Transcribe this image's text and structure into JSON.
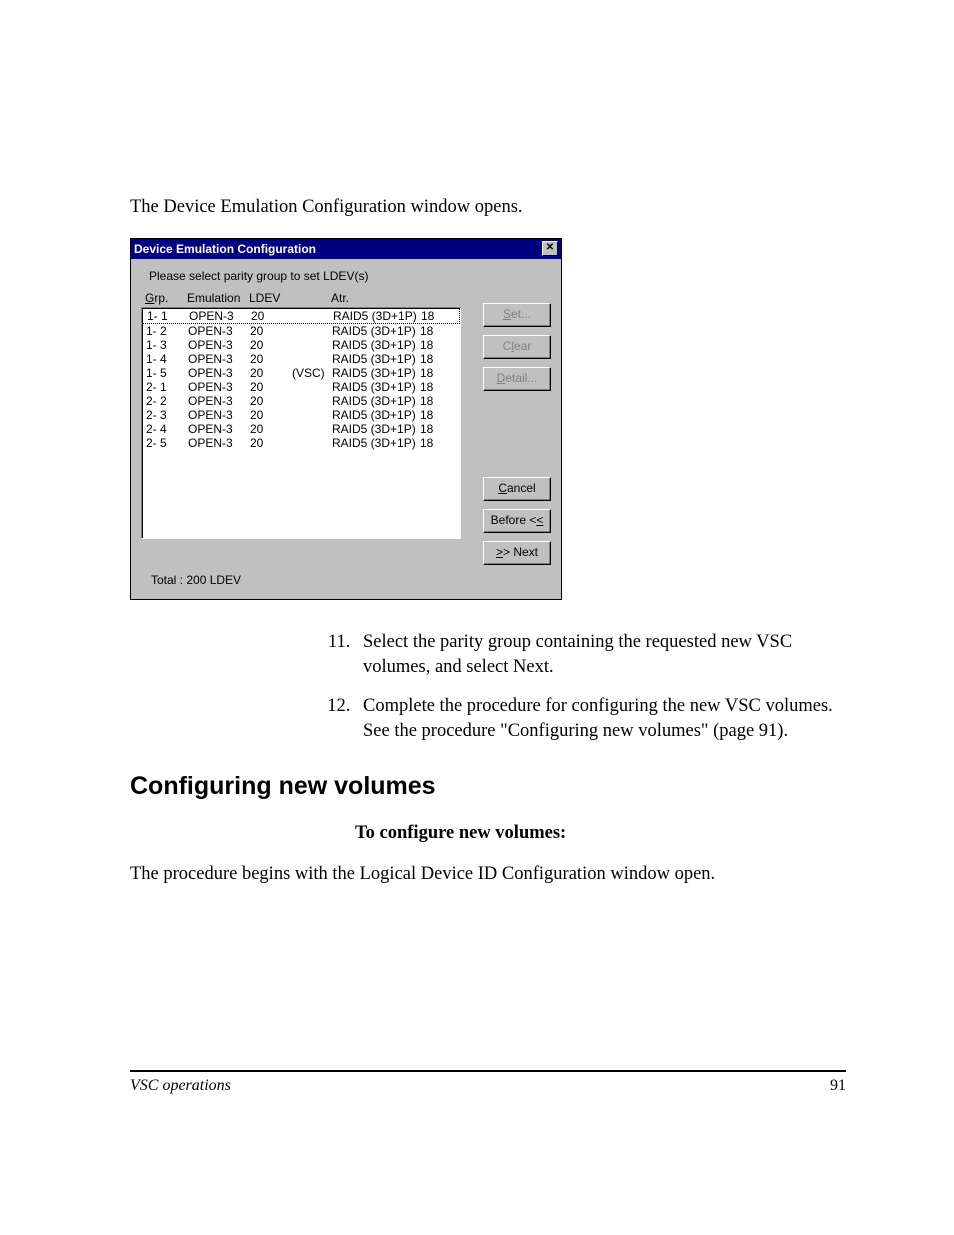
{
  "intro_text": "The Device Emulation Configuration window opens.",
  "window": {
    "title": "Device Emulation Configuration",
    "instruction": "Please select parity group to set LDEV(s)",
    "headers": {
      "grp": "Grp.",
      "grp_u": "G",
      "emulation": "Emulation",
      "ldev": "LDEV",
      "atr": "Atr."
    },
    "rows": [
      {
        "grp": "1- 1",
        "emu": "OPEN-3",
        "ldev": "20",
        "vsc": "",
        "atr1": "RAID5 (3D+1P)",
        "atr2": "18",
        "selected": true
      },
      {
        "grp": "1- 2",
        "emu": "OPEN-3",
        "ldev": "20",
        "vsc": "",
        "atr1": "RAID5 (3D+1P)",
        "atr2": "18"
      },
      {
        "grp": "1- 3",
        "emu": "OPEN-3",
        "ldev": "20",
        "vsc": "",
        "atr1": "RAID5 (3D+1P)",
        "atr2": "18"
      },
      {
        "grp": "1- 4",
        "emu": "OPEN-3",
        "ldev": "20",
        "vsc": "",
        "atr1": "RAID5 (3D+1P)",
        "atr2": "18"
      },
      {
        "grp": "1- 5",
        "emu": "OPEN-3",
        "ldev": "20",
        "vsc": "(VSC)",
        "atr1": "RAID5 (3D+1P)",
        "atr2": "18"
      },
      {
        "grp": "2- 1",
        "emu": "OPEN-3",
        "ldev": "20",
        "vsc": "",
        "atr1": "RAID5 (3D+1P)",
        "atr2": "18"
      },
      {
        "grp": "2- 2",
        "emu": "OPEN-3",
        "ldev": "20",
        "vsc": "",
        "atr1": "RAID5 (3D+1P)",
        "atr2": "18"
      },
      {
        "grp": "2- 3",
        "emu": "OPEN-3",
        "ldev": "20",
        "vsc": "",
        "atr1": "RAID5 (3D+1P)",
        "atr2": "18"
      },
      {
        "grp": "2- 4",
        "emu": "OPEN-3",
        "ldev": "20",
        "vsc": "",
        "atr1": "RAID5 (3D+1P)",
        "atr2": "18"
      },
      {
        "grp": "2- 5",
        "emu": "OPEN-3",
        "ldev": "20",
        "vsc": "",
        "atr1": "RAID5 (3D+1P)",
        "atr2": "18"
      }
    ],
    "buttons": {
      "set": "Set...",
      "clear": "Clear",
      "detail": "Detail...",
      "cancel": "Cancel",
      "before": "Before <<",
      "next": ">> Next"
    },
    "total": "Total : 200 LDEV",
    "close_x": "✕"
  },
  "steps": {
    "s11": "Select the parity group containing the requested new VSC volumes, and select Next.",
    "s12": "Complete the procedure for configuring the new VSC volumes. See the procedure \"Configuring new volumes\" (page 91)."
  },
  "section_heading": "Configuring new volumes",
  "bold_intro": "To configure new volumes:",
  "body_text": "The procedure begins with the Logical Device ID Configuration window open.",
  "footer": {
    "left": "VSC operations",
    "right": "91"
  }
}
